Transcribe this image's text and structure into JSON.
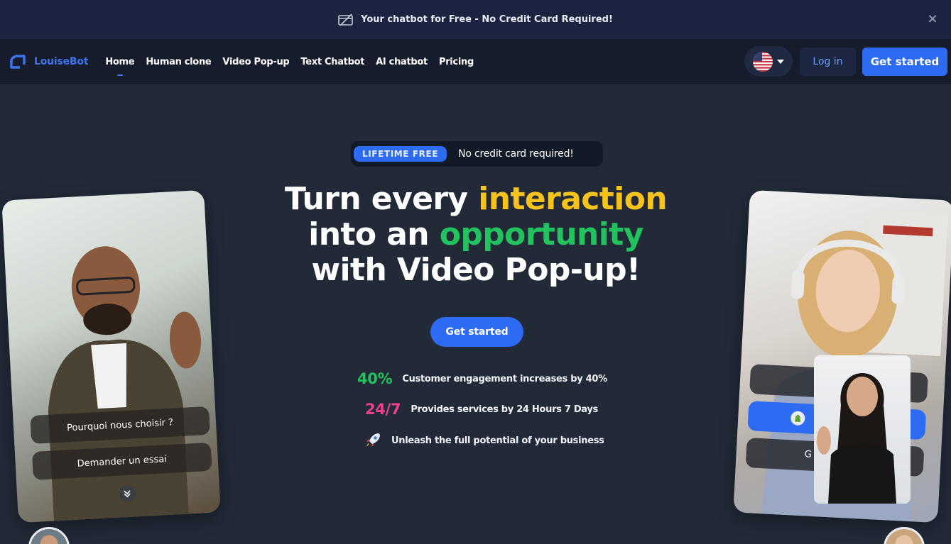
{
  "announcement": {
    "text": "Your chatbot for Free - No Credit Card Required!",
    "close_symbol": "×"
  },
  "nav": {
    "brand": "LouiseBot",
    "menu": [
      {
        "label": "Home",
        "active": true
      },
      {
        "label": "Human clone",
        "active": false
      },
      {
        "label": "Video Pop-up",
        "active": false
      },
      {
        "label": "Text Chatbot",
        "active": false
      },
      {
        "label": "AI chatbot",
        "active": false
      },
      {
        "label": "Pricing",
        "active": false
      }
    ],
    "login": "Log in",
    "get_started": "Get started"
  },
  "hero": {
    "badge": "LIFETIME FREE",
    "badge_sub": "No credit card required!",
    "headline": {
      "line1_a": "Turn every ",
      "line1_b": "interaction",
      "line2_a": "into an ",
      "line2_b": "opportunity",
      "line3": "with Video Pop-up!"
    },
    "cta": "Get started",
    "stats": [
      {
        "num": "40%",
        "text": "Customer engagement increases by 40%"
      },
      {
        "num": "24/7",
        "text": "Provides services by 24 Hours 7 Days"
      },
      {
        "icon": "rocket-icon",
        "text": "Unleash the full potential of your business"
      }
    ]
  },
  "left_card": {
    "chips": [
      "Pourquoi nous choisir ?",
      "Demander un essai"
    ]
  },
  "right_card": {
    "partial_text": "G"
  },
  "colors": {
    "accent": "#2d6bf2",
    "yellow": "#f6c21c",
    "green": "#22c35e",
    "pink": "#ef3f8d",
    "background": "#222a38"
  }
}
